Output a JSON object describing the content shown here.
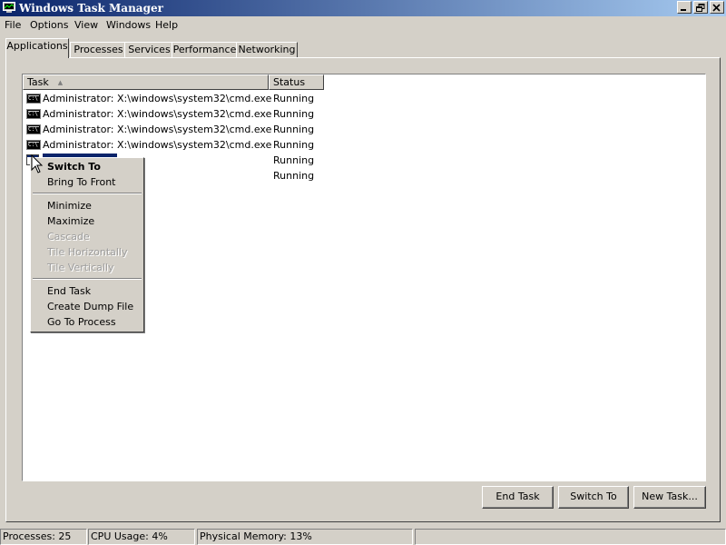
{
  "window": {
    "title": "Windows Task Manager"
  },
  "menubar": {
    "items": [
      "File",
      "Options",
      "View",
      "Windows",
      "Help"
    ]
  },
  "tabs": [
    {
      "label": "Applications",
      "active": true
    },
    {
      "label": "Processes"
    },
    {
      "label": "Services"
    },
    {
      "label": "Performance"
    },
    {
      "label": "Networking"
    }
  ],
  "list": {
    "columns": {
      "task": "Task",
      "status": "Status"
    },
    "rows": [
      {
        "task": "Administrator: X:\\windows\\system32\\cmd.exe",
        "status": "Running",
        "icon": "cmd-icon"
      },
      {
        "task": "Administrator: X:\\windows\\system32\\cmd.exe",
        "status": "Running",
        "icon": "cmd-icon"
      },
      {
        "task": "Administrator: X:\\windows\\system32\\cmd.exe",
        "status": "Running",
        "icon": "cmd-icon"
      },
      {
        "task": "Administrator: X:\\windows\\system32\\cmd.exe",
        "status": "Running",
        "icon": "cmd-icon"
      },
      {
        "task": "",
        "status": "Running",
        "icon": "application-icon",
        "selected": true
      },
      {
        "task": "",
        "status": "Running"
      }
    ]
  },
  "context_menu": {
    "items": [
      {
        "label": "Switch To",
        "bold": true
      },
      {
        "label": "Bring To Front"
      },
      {
        "label": "Minimize"
      },
      {
        "label": "Maximize"
      },
      {
        "label": "Cascade",
        "disabled": true
      },
      {
        "label": "Tile Horizontally",
        "disabled": true
      },
      {
        "label": "Tile Vertically",
        "disabled": true
      },
      {
        "label": "End Task"
      },
      {
        "label": "Create Dump File"
      },
      {
        "label": "Go To Process"
      }
    ]
  },
  "buttons": {
    "end_task": "End Task",
    "switch_to": "Switch To",
    "new_task": "New Task..."
  },
  "statusbar": {
    "processes": "Processes: 25",
    "cpu": "CPU Usage: 4%",
    "memory": "Physical Memory: 13%"
  },
  "colors": {
    "titlebar_start": "#0a246a",
    "titlebar_end": "#a6caf0",
    "selection": "#0a246a",
    "face": "#d4d0c8"
  }
}
